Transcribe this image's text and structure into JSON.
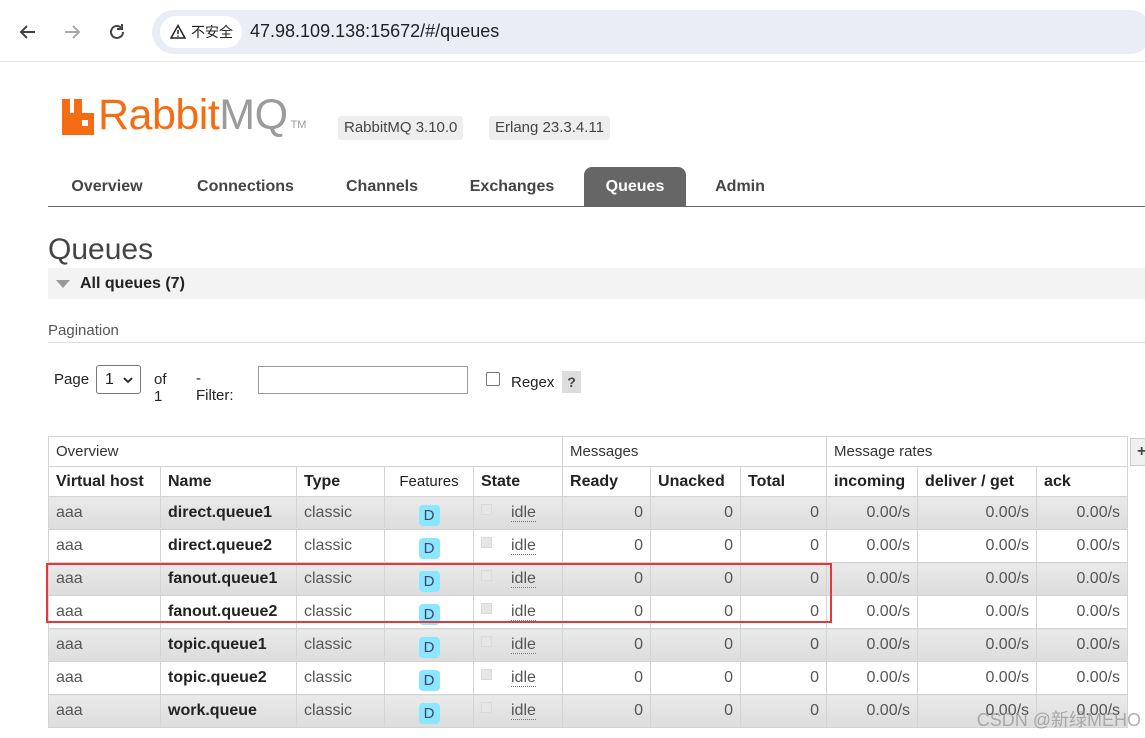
{
  "browser": {
    "security_label": "不安全",
    "url": "47.98.109.138:15672/#/queues"
  },
  "header": {
    "logo_rabbit": "Rabbit",
    "logo_mq": "MQ",
    "logo_tm": "TM",
    "rabbitmq_version": "RabbitMQ 3.10.0",
    "erlang_version": "Erlang 23.3.4.11",
    "brand_color": "#f46d12"
  },
  "tabs": [
    {
      "label": "Overview"
    },
    {
      "label": "Connections"
    },
    {
      "label": "Channels"
    },
    {
      "label": "Exchanges"
    },
    {
      "label": "Queues",
      "active": true
    },
    {
      "label": "Admin"
    }
  ],
  "page": {
    "title": "Queues",
    "section_label": "All queues (7)",
    "pagination_label": "Pagination",
    "page_label": "Page",
    "page_selected": "1",
    "of_label": "of 1",
    "filter_label": "- Filter:",
    "filter_value": "",
    "regex_label": "Regex",
    "help_label": "?",
    "plus_label": "+"
  },
  "table": {
    "groups": [
      "Overview",
      "Messages",
      "Message rates"
    ],
    "columns": [
      "Virtual host",
      "Name",
      "Type",
      "Features",
      "State",
      "Ready",
      "Unacked",
      "Total",
      "incoming",
      "deliver / get",
      "ack"
    ],
    "rows": [
      {
        "vhost": "aaa",
        "name": "direct.queue1",
        "type": "classic",
        "feature": "D",
        "state": "idle",
        "ready": "0",
        "unacked": "0",
        "total": "0",
        "incoming": "0.00/s",
        "deliver": "0.00/s",
        "ack": "0.00/s"
      },
      {
        "vhost": "aaa",
        "name": "direct.queue2",
        "type": "classic",
        "feature": "D",
        "state": "idle",
        "ready": "0",
        "unacked": "0",
        "total": "0",
        "incoming": "0.00/s",
        "deliver": "0.00/s",
        "ack": "0.00/s"
      },
      {
        "vhost": "aaa",
        "name": "fanout.queue1",
        "type": "classic",
        "feature": "D",
        "state": "idle",
        "ready": "0",
        "unacked": "0",
        "total": "0",
        "incoming": "0.00/s",
        "deliver": "0.00/s",
        "ack": "0.00/s"
      },
      {
        "vhost": "aaa",
        "name": "fanout.queue2",
        "type": "classic",
        "feature": "D",
        "state": "idle",
        "ready": "0",
        "unacked": "0",
        "total": "0",
        "incoming": "0.00/s",
        "deliver": "0.00/s",
        "ack": "0.00/s"
      },
      {
        "vhost": "aaa",
        "name": "topic.queue1",
        "type": "classic",
        "feature": "D",
        "state": "idle",
        "ready": "0",
        "unacked": "0",
        "total": "0",
        "incoming": "0.00/s",
        "deliver": "0.00/s",
        "ack": "0.00/s"
      },
      {
        "vhost": "aaa",
        "name": "topic.queue2",
        "type": "classic",
        "feature": "D",
        "state": "idle",
        "ready": "0",
        "unacked": "0",
        "total": "0",
        "incoming": "0.00/s",
        "deliver": "0.00/s",
        "ack": "0.00/s"
      },
      {
        "vhost": "aaa",
        "name": "work.queue",
        "type": "classic",
        "feature": "D",
        "state": "idle",
        "ready": "0",
        "unacked": "0",
        "total": "0",
        "incoming": "0.00/s",
        "deliver": "0.00/s",
        "ack": "0.00/s"
      }
    ]
  },
  "watermark": "CSDN @新绿MEHO"
}
